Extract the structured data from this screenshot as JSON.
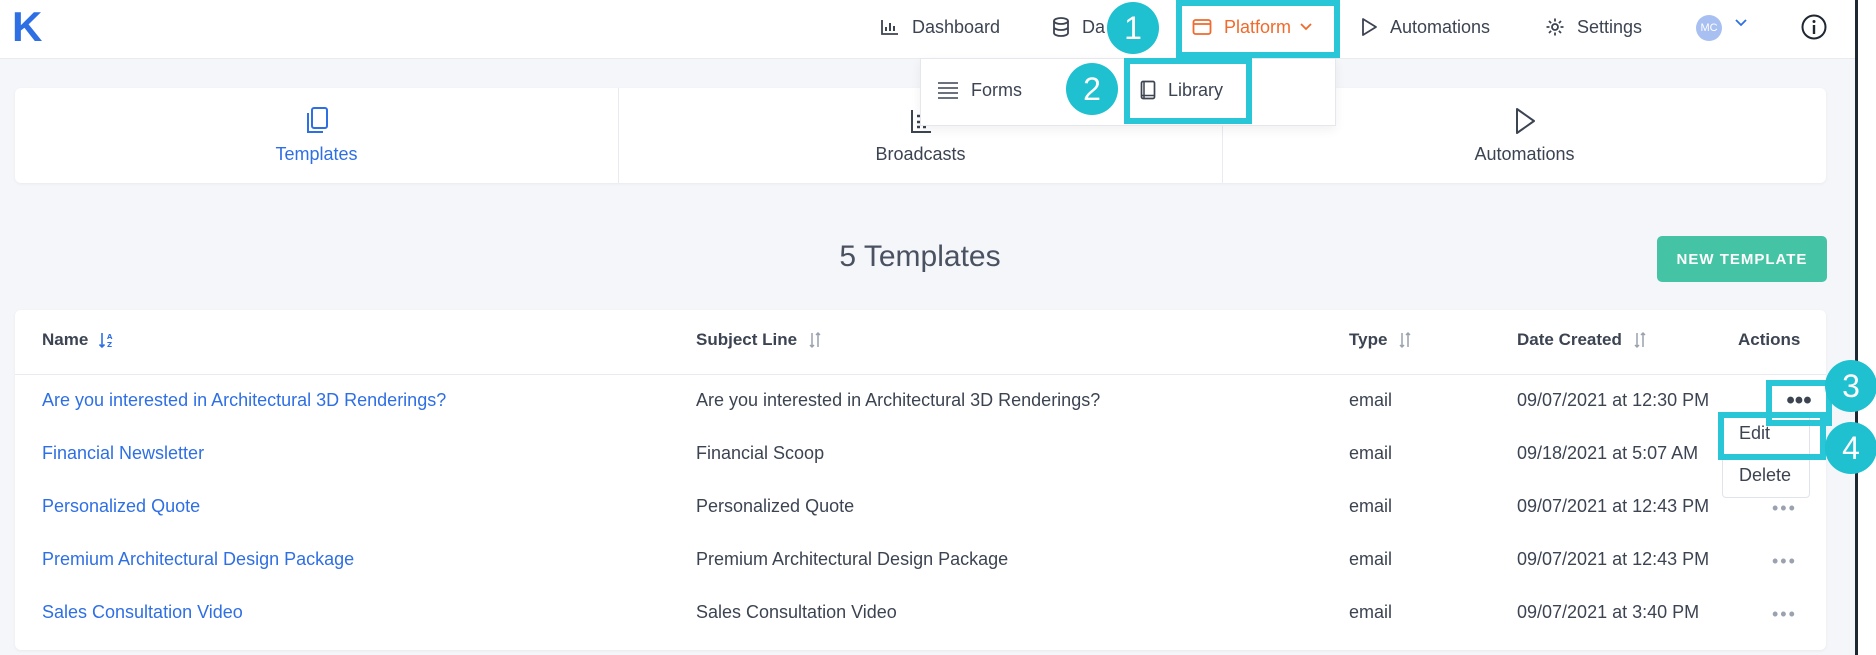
{
  "app": {
    "logo_letter": "K",
    "brand_color": "#2f6fe4",
    "accent_color": "#f06a2c"
  },
  "nav": {
    "dashboard": {
      "label": "Dashboard",
      "icon": "bar-chart-icon"
    },
    "data": {
      "label": "Da",
      "icon": "database-icon"
    },
    "platform": {
      "label": "Platform",
      "icon": "calendar-icon"
    },
    "automations": {
      "label": "Automations",
      "icon": "play-icon"
    },
    "settings": {
      "label": "Settings",
      "icon": "gear-icon"
    },
    "avatar": "MC",
    "info_icon": "info-icon"
  },
  "platform_menu": {
    "forms": {
      "label": "Forms",
      "icon": "list-icon"
    },
    "library": {
      "label": "Library",
      "icon": "book-icon"
    }
  },
  "tabs": [
    {
      "label": "Templates",
      "icon": "copy-icon",
      "active": true
    },
    {
      "label": "Broadcasts",
      "icon": "broadcast-icon",
      "active": false
    },
    {
      "label": "Automations",
      "icon": "play-icon",
      "active": false
    }
  ],
  "page": {
    "title": "5 Templates",
    "new_button": "NEW TEMPLATE"
  },
  "table": {
    "columns": {
      "name": "Name",
      "subject": "Subject Line",
      "type": "Type",
      "date": "Date Created",
      "actions": "Actions"
    },
    "rows": [
      {
        "name": "Are you interested in Architectural 3D Renderings?",
        "subject": "Are you interested in Architectural 3D Renderings?",
        "type": "email",
        "date": "09/07/2021 at 12:30 PM"
      },
      {
        "name": "Financial Newsletter",
        "subject": "Financial Scoop",
        "type": "email",
        "date": "09/18/2021 at 5:07 AM"
      },
      {
        "name": "Personalized Quote",
        "subject": "Personalized Quote",
        "type": "email",
        "date": "09/07/2021 at 12:43 PM"
      },
      {
        "name": "Premium Architectural Design Package",
        "subject": "Premium Architectural Design Package",
        "type": "email",
        "date": "09/07/2021 at 12:43 PM"
      },
      {
        "name": "Sales Consultation Video",
        "subject": "Sales Consultation Video",
        "type": "email",
        "date": "09/07/2021 at 3:40 PM"
      }
    ]
  },
  "row_menu": {
    "edit": "Edit",
    "delete": "Delete"
  },
  "callouts": [
    "1",
    "2",
    "3",
    "4"
  ],
  "callout_color": "#28c6d6"
}
